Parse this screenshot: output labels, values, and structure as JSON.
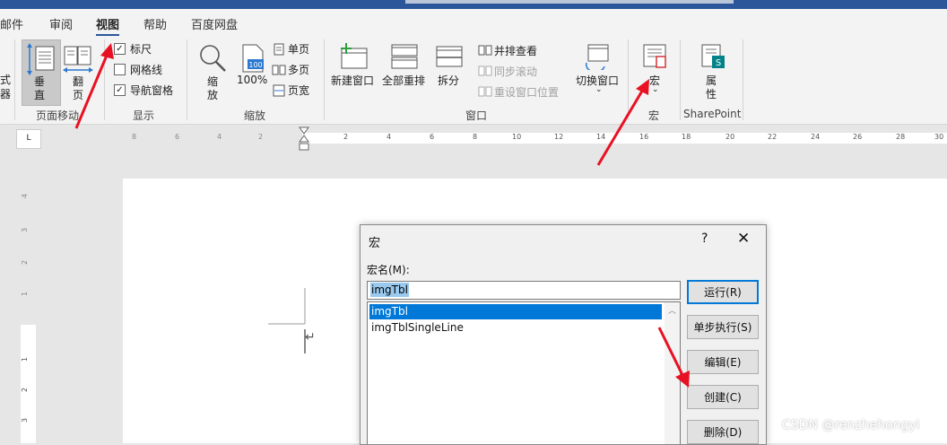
{
  "tabs": [
    {
      "label": "邮件"
    },
    {
      "label": "审阅"
    },
    {
      "label": "视图"
    },
    {
      "label": "帮助"
    },
    {
      "label": "百度网盘"
    }
  ],
  "ribbon": {
    "left_edge": {
      "line1": "式",
      "line2": "器"
    },
    "page_move": {
      "vertical_line1": "垂",
      "vertical_line2": "直",
      "flip_line1": "翻",
      "flip_line2": "页",
      "group": "页面移动"
    },
    "show": {
      "ruler": "标尺",
      "gridlines": "网格线",
      "nav_pane": "导航窗格",
      "group": "显示"
    },
    "zoom": {
      "zoom_line1": "缩",
      "zoom_line2": "放",
      "hundred": "100%",
      "hundred_icon_text": "100",
      "one_page": "单页",
      "multi_page": "多页",
      "page_width": "页宽",
      "group": "缩放"
    },
    "window": {
      "new_window": "新建窗口",
      "arrange_all": "全部重排",
      "split": "拆分",
      "side_by_side": "并排查看",
      "sync_scroll": "同步滚动",
      "reset_pos": "重设窗口位置",
      "switch_window": "切换窗口",
      "group": "窗口"
    },
    "macros": {
      "label": "宏",
      "group": "宏"
    },
    "sharepoint": {
      "line1": "属",
      "line2": "性",
      "group": "SharePoint"
    }
  },
  "ruler": {
    "corner": "L",
    "top_left_numbers": [
      "8",
      "6",
      "4",
      "2"
    ],
    "top_right_numbers": [
      "2",
      "4",
      "6",
      "8",
      "10",
      "12",
      "14",
      "16",
      "18",
      "20",
      "22",
      "24",
      "26",
      "28",
      "30"
    ],
    "left_numbers": [
      "4",
      "3",
      "2",
      "1",
      "1",
      "2",
      "3"
    ]
  },
  "dialog": {
    "title": "宏",
    "help": "?",
    "close": "✕",
    "name_label": "宏名(M):",
    "input_value": "imgTbl",
    "list": [
      "imgTbl",
      "imgTblSingleLine"
    ],
    "buttons": {
      "run": "运行(R)",
      "step": "单步执行(S)",
      "edit": "编辑(E)",
      "create": "创建(C)",
      "delete": "删除(D)"
    }
  },
  "colors": {
    "accent": "#2b579a",
    "selection": "#0078d7",
    "annotation": "#e81123"
  },
  "watermark": "CSDN @renzhehongyi"
}
